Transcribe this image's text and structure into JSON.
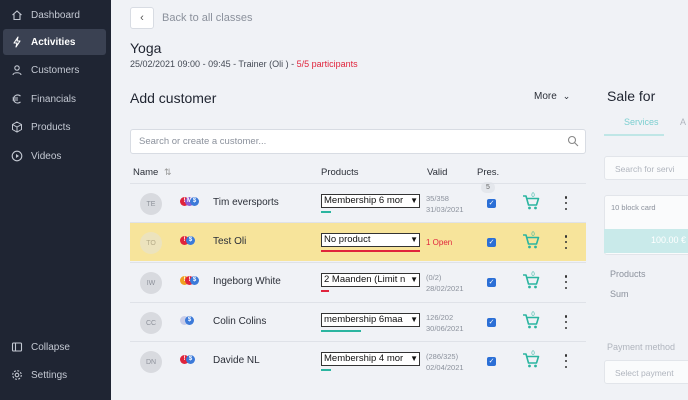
{
  "sidebar": {
    "items": [
      {
        "label": "Dashboard",
        "icon": "home-icon"
      },
      {
        "label": "Activities",
        "icon": "lightning-icon",
        "active": true
      },
      {
        "label": "Customers",
        "icon": "user-icon"
      },
      {
        "label": "Financials",
        "icon": "euro-icon"
      },
      {
        "label": "Products",
        "icon": "box-icon"
      },
      {
        "label": "Videos",
        "icon": "play-icon"
      }
    ],
    "collapse_label": "Collapse",
    "settings_label": "Settings"
  },
  "header": {
    "back_label": "Back to all classes",
    "title": "Yoga",
    "subtitle_prefix": "25/02/2021 09:00 - 09:45 - Trainer (Oli ) - ",
    "participants": "5/5 participants"
  },
  "section": {
    "title": "Add customer",
    "more_label": "More"
  },
  "search": {
    "placeholder": "Search or create a customer..."
  },
  "table": {
    "columns": {
      "name": "Name",
      "products": "Products",
      "valid": "Valid",
      "presence": "Pres."
    },
    "presence_count": "5",
    "rows": [
      {
        "initials": "TE",
        "name": "Tim eversports",
        "product": "Membership 6 mor",
        "valid_line1": "35/358",
        "valid_line2": "31/03/2021",
        "highlight": false,
        "line_color": "#2bb5a0"
      },
      {
        "initials": "TO",
        "name": "Test Oli",
        "product": "No product",
        "valid_line1": "1 Open",
        "valid_line2": "",
        "highlight": true,
        "line_color": "#e0243c"
      },
      {
        "initials": "IW",
        "name": "Ingeborg White",
        "product": "2 Maanden (Limit n",
        "valid_line1": "(0/2)",
        "valid_line2": "28/02/2021",
        "highlight": false,
        "line_color": "#e0243c"
      },
      {
        "initials": "CC",
        "name": "Colin Colins",
        "product": "membership 6maa",
        "valid_line1": "126/202",
        "valid_line2": "30/06/2021",
        "highlight": false,
        "line_color": "#2bb5a0"
      },
      {
        "initials": "DN",
        "name": "Davide NL",
        "product": "Membership 4 mor",
        "valid_line1": "(286/325)",
        "valid_line2": "02/04/2021",
        "highlight": false,
        "line_color": "#2bb5a0"
      }
    ]
  },
  "side_panel": {
    "title": "Sale for",
    "tab_services": "Services",
    "tab_other": "A",
    "search_placeholder": "Search for servi",
    "item_label": "10 block card",
    "item_price": "100.00 €",
    "products_label": "Products",
    "sum_label": "Sum",
    "payment_method_label": "Payment method",
    "select_payment_placeholder": "Select payment"
  },
  "colors": {
    "sidebar_bg": "#1f2533",
    "accent_teal": "#2bb5a0",
    "alert_red": "#e0243c",
    "highlight_row": "#f7e49b"
  }
}
